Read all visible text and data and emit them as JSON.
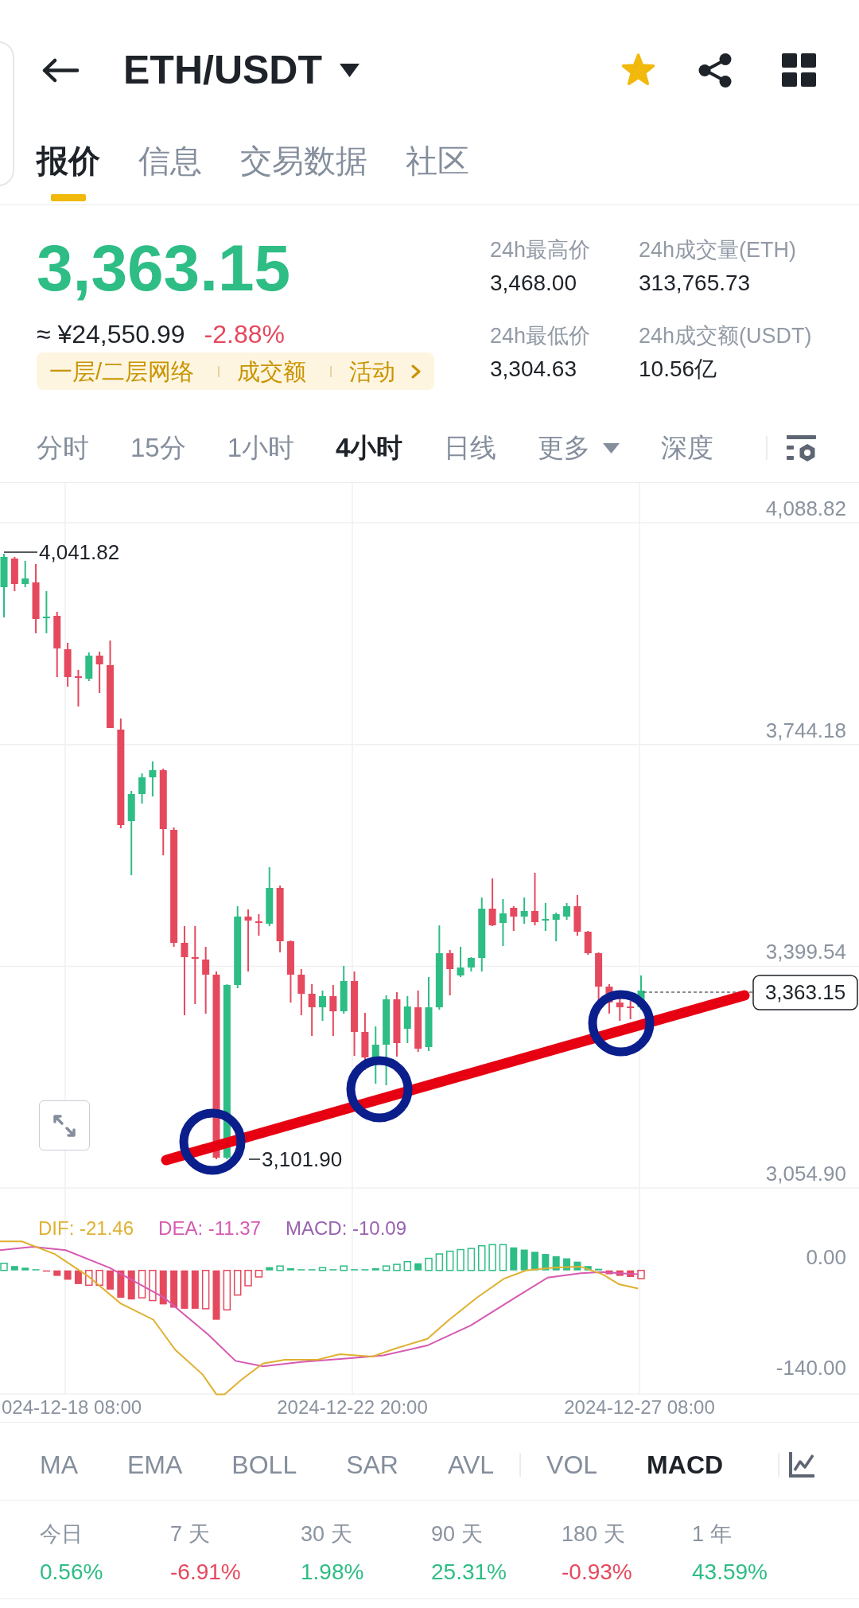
{
  "header": {
    "pair": "ETH/USDT",
    "favorite": true
  },
  "tabs": [
    {
      "label": "报价",
      "selected": true
    },
    {
      "label": "信息",
      "selected": false
    },
    {
      "label": "交易数据",
      "selected": false
    },
    {
      "label": "社区",
      "selected": false
    }
  ],
  "quote": {
    "price": "3,363.15",
    "price_rising": true,
    "fiat": "≈ ¥24,550.99",
    "change": "-2.88%",
    "change_rising": false,
    "tags": [
      "一层/二层网络",
      "成交额",
      "活动"
    ]
  },
  "stats": [
    {
      "label": "24h最高价",
      "value": "3,468.00"
    },
    {
      "label": "24h成交量(ETH)",
      "value": "313,765.73"
    },
    {
      "label": "24h最低价",
      "value": "3,304.63"
    },
    {
      "label": "24h成交额(USDT)",
      "value": "10.56亿"
    }
  ],
  "intervals": [
    {
      "label": "分时",
      "kind": "option",
      "selected": false
    },
    {
      "label": "15分",
      "kind": "option",
      "selected": false
    },
    {
      "label": "1小时",
      "kind": "option",
      "selected": false
    },
    {
      "label": "4小时",
      "kind": "option",
      "selected": true
    },
    {
      "label": "日线",
      "kind": "option",
      "selected": false
    },
    {
      "label": "更多",
      "kind": "menu",
      "selected": false
    },
    {
      "label": "深度",
      "kind": "option",
      "selected": false
    }
  ],
  "chart": {
    "price_axis": [
      "4,088.82",
      "3,744.18",
      "3,399.54",
      "3,054.90"
    ],
    "high_marker": "4,041.82",
    "low_marker": "3,101.90",
    "last_price": "3,363.15"
  },
  "macd": {
    "legend": [
      {
        "label": "DIF: -21.46",
        "color": "#e0b031"
      },
      {
        "label": "DEA: -11.37",
        "color": "#d65ab2"
      },
      {
        "label": "MACD: -10.09",
        "color": "#9a62b0"
      }
    ],
    "axis": [
      "0.00",
      "-140.00"
    ]
  },
  "time_axis": [
    "024-12-18 08:00",
    "2024-12-22 20:00",
    "2024-12-27 08:00"
  ],
  "indicators": {
    "main": [
      {
        "label": "MA",
        "selected": false
      },
      {
        "label": "EMA",
        "selected": false
      },
      {
        "label": "BOLL",
        "selected": false
      },
      {
        "label": "SAR",
        "selected": false
      },
      {
        "label": "AVL",
        "selected": false
      }
    ],
    "sub": [
      {
        "label": "VOL",
        "selected": false
      },
      {
        "label": "MACD",
        "selected": true
      }
    ]
  },
  "performance": [
    {
      "period": "今日",
      "change": "0.56%",
      "color": "#2ebd85"
    },
    {
      "period": "7 天",
      "change": "-6.91%",
      "color": "#e5495e"
    },
    {
      "period": "30 天",
      "change": "1.98%",
      "color": "#2ebd85"
    },
    {
      "period": "90 天",
      "change": "25.31%",
      "color": "#2ebd85"
    },
    {
      "period": "180 天",
      "change": "-0.93%",
      "color": "#e5495e"
    },
    {
      "period": "1 年",
      "change": "43.59%",
      "color": "#2ebd85"
    }
  ]
}
